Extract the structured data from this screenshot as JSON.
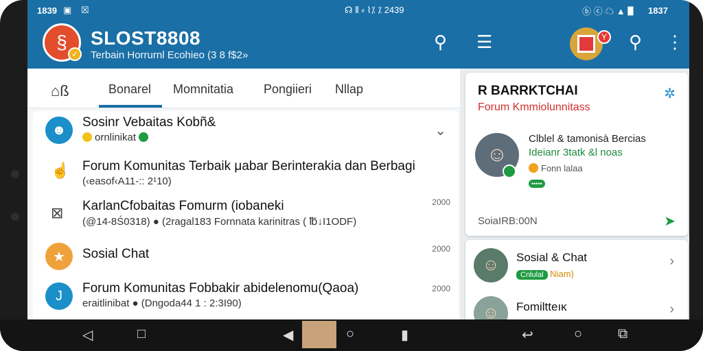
{
  "status_bar": {
    "left_time": "1839",
    "center_text": "☊ ⦀ ⸗ ⌇⁒ ⁒ 2439",
    "right_time": "1837"
  },
  "app_bar": {
    "title": "SLOST8808",
    "subtitle": "Terbain Horrurnl Ecohieo (3 8 f$2»",
    "icons": [
      "search-icon",
      "menu-icon",
      "search-icon",
      "more-vert-icon"
    ],
    "notification_count": "Y"
  },
  "tabs": [
    {
      "label": "Bonarel",
      "active": true
    },
    {
      "label": "Momnitatia",
      "active": false
    },
    {
      "label": "Pongiieri",
      "active": false
    },
    {
      "label": "Nllap",
      "active": false
    }
  ],
  "list": [
    {
      "title": "Sosinr Vebaitas Kobñ&",
      "meta": "ornlinikat",
      "date": ""
    },
    {
      "title": "Forum Komunitas Terbaik μabar Berinterakia dan Berbagi",
      "meta": "(‹easof‹A11-:: 2¹10)",
      "date": ""
    },
    {
      "title": "KarlanCfobaitas Fomurm (iobaneki",
      "meta": "(@14-8Ś0318) ● (2ragal183 Fornnata karinitras ( ℔↓I1ODF)",
      "date": "2000"
    },
    {
      "title": "Sosial Chat",
      "meta": "",
      "date": "2000"
    },
    {
      "title": "Forum Komunitas Fobbakir abidelenomu(Qaoa)",
      "meta": "eraitlinibat ● (Dngoda44 1 : 2:3I90)",
      "date": "2000"
    }
  ],
  "right_card": {
    "title": "R BARRKTCHAI",
    "subtitle": "Forum Kmmiolunnitass",
    "line1": "Clblel & tamonisà Bercias",
    "line2": "Ideianr 3tatk &l ­noas",
    "line3": "Fonn lalaa",
    "pill": "•••••",
    "footer": "SoiaIRB:00N"
  },
  "right_list": [
    {
      "title": "Sosial & Chat",
      "pill": "Cnlulal",
      "meta": "Niam)"
    },
    {
      "title": "Fomilttеıκ",
      "pill": "",
      "meta": ""
    }
  ]
}
